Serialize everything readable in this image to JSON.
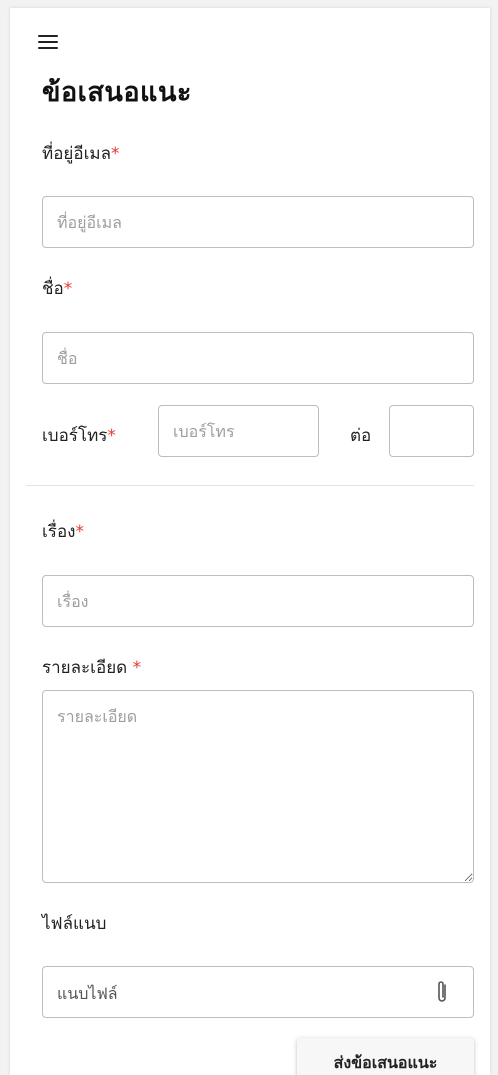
{
  "header": {
    "title": "ข้อเสนอแนะ",
    "menu_icon": "hamburger-menu-icon"
  },
  "form": {
    "email": {
      "label": "ที่อยู่อีเมล",
      "required_mark": "*",
      "placeholder": "ที่อยู่อีเมล",
      "value": ""
    },
    "name": {
      "label": "ชื่อ",
      "required_mark": "*",
      "placeholder": "ชื่อ",
      "value": ""
    },
    "phone": {
      "label": "เบอร์โทร",
      "required_mark": "*",
      "placeholder": "เบอร์โทร",
      "value": ""
    },
    "extension": {
      "label": "ต่อ",
      "value": ""
    },
    "subject": {
      "label": "เรื่อง",
      "required_mark": "*",
      "placeholder": "เรื่อง",
      "value": ""
    },
    "details": {
      "label": "รายละเอียด ",
      "required_mark": "*",
      "placeholder": "รายละเอียด",
      "value": ""
    },
    "attachment": {
      "label": "ไฟล์แนบ",
      "button_text": "แนบไฟล์",
      "icon": "paperclip-icon"
    },
    "submit_label": "ส่งข้อเสนอแนะ"
  },
  "colors": {
    "required": "#e53935",
    "border": "#bdbdbd",
    "background": "#ffffff"
  }
}
